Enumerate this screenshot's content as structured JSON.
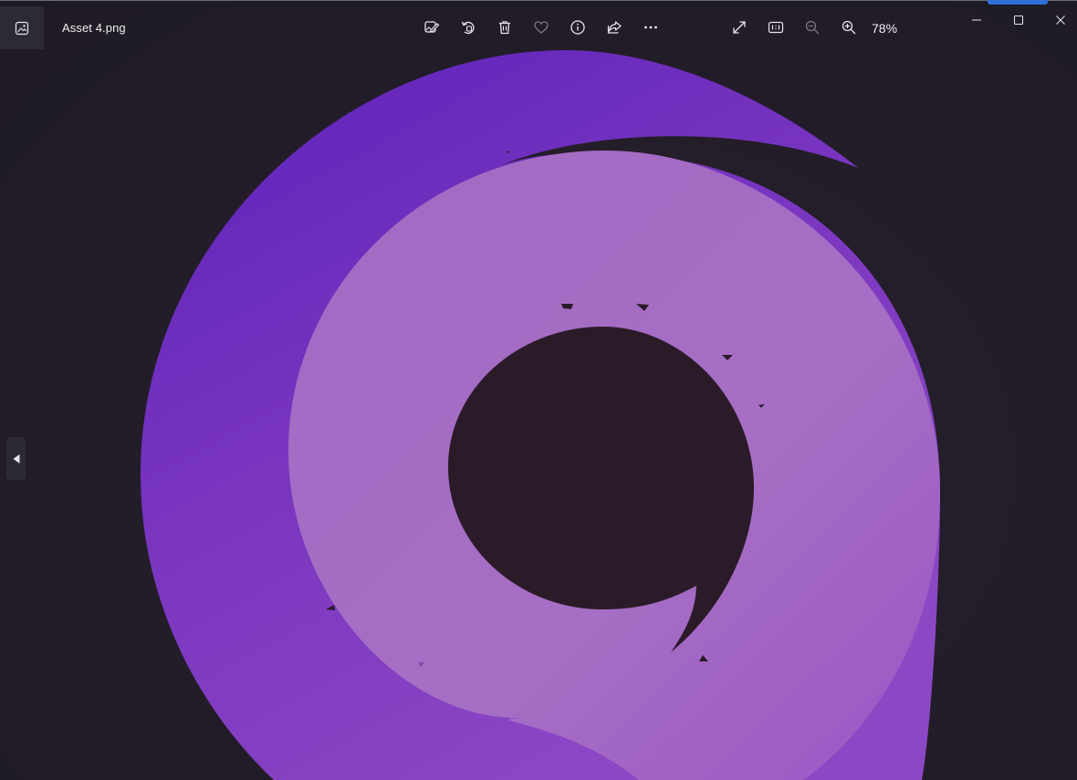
{
  "window": {
    "file_name": "Asset 4.png",
    "zoom_level": "78%"
  },
  "toolbar": {
    "items": [
      {
        "name": "edit-image-icon"
      },
      {
        "name": "rotate-icon"
      },
      {
        "name": "delete-icon"
      },
      {
        "name": "favorite-icon"
      },
      {
        "name": "info-icon"
      },
      {
        "name": "share-icon"
      },
      {
        "name": "more-icon"
      },
      {
        "name": "fullscreen-icon"
      },
      {
        "name": "actual-size-icon"
      },
      {
        "name": "zoom-out-icon"
      },
      {
        "name": "zoom-in-icon"
      }
    ]
  },
  "window_controls": {
    "minimize": "minimize-icon",
    "maximize": "maximize-icon",
    "close": "close-icon"
  },
  "image": {
    "colors": {
      "outer_ring": "#7c3dc4",
      "outer_ring_dark": "#5b22b8",
      "inner_ring": "#a56dc4",
      "center": "#2a1b29",
      "background": "#231d29"
    }
  },
  "navigation": {
    "previous": "chevron-left-icon"
  }
}
